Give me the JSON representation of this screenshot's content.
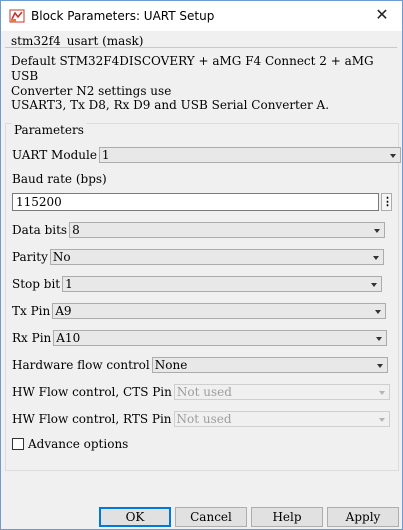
{
  "window": {
    "title": "Block Parameters: UART Setup",
    "close_label": "✕"
  },
  "mask": {
    "title": "stm32f4_usart (mask)",
    "description_line1": "Default STM32F4DISCOVERY + aMG F4 Connect 2 + aMG USB\nConverter N2 settings use",
    "description_line2": "USART3, Tx D8, Rx D9 and USB Serial Converter A."
  },
  "parameters": {
    "group_label": "Parameters",
    "uart_module": {
      "label": "UART Module",
      "value": "1"
    },
    "baud_rate": {
      "label": "Baud rate (bps)",
      "value": "115200",
      "more_button": "⋮"
    },
    "data_bits": {
      "label": "Data bits",
      "value": "8"
    },
    "parity": {
      "label": "Parity",
      "value": "No"
    },
    "stop_bit": {
      "label": "Stop bit",
      "value": "1"
    },
    "tx_pin": {
      "label": "Tx Pin",
      "value": "A9"
    },
    "rx_pin": {
      "label": "Rx Pin",
      "value": "A10"
    },
    "hw_flow": {
      "label": "Hardware flow control",
      "value": "None"
    },
    "cts_pin": {
      "label": "HW Flow control, CTS Pin",
      "value": "Not used"
    },
    "rts_pin": {
      "label": "HW Flow control, RTS Pin",
      "value": "Not used"
    },
    "advance": {
      "label": "Advance options",
      "checked": false
    }
  },
  "buttons": {
    "ok": "OK",
    "cancel": "Cancel",
    "help": "Help",
    "apply": "Apply"
  },
  "colors": {
    "focus_border": "#0078d7",
    "window_border": "#6b9bd1"
  },
  "icons": {
    "app": "simulink-block-icon",
    "close": "close-icon"
  }
}
